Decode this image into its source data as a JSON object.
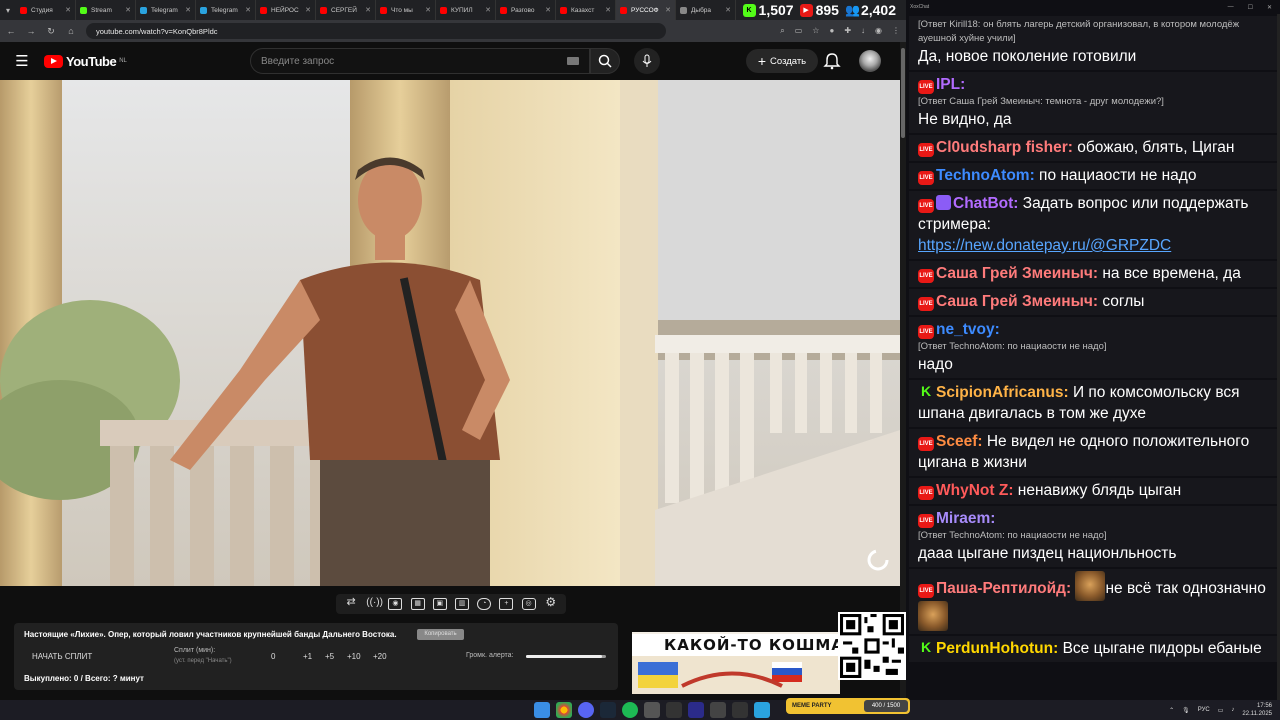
{
  "browser": {
    "tabs": [
      {
        "label": "Студия",
        "color": "#ff0000",
        "active": false
      },
      {
        "label": "Stream",
        "color": "#53fc18",
        "active": false
      },
      {
        "label": "Telegram",
        "color": "#2aa3df",
        "active": false
      },
      {
        "label": "Telegram",
        "color": "#2aa3df",
        "active": false
      },
      {
        "label": "НЕЙРОС",
        "color": "#ff0000",
        "active": false
      },
      {
        "label": "СЕРГЕЙ",
        "color": "#ff0000",
        "active": false
      },
      {
        "label": "Что мы",
        "color": "#ff0000",
        "active": false
      },
      {
        "label": "КУПИЛ",
        "color": "#ff0000",
        "active": false
      },
      {
        "label": "Разгово",
        "color": "#ff0000",
        "active": false
      },
      {
        "label": "Казахст",
        "color": "#ff0000",
        "active": false
      },
      {
        "label": "РУССОФ",
        "color": "#ff0000",
        "active": true
      },
      {
        "label": "Дыбра",
        "color": "#888888",
        "active": false
      }
    ],
    "url": "youtube.com/watch?v=KonQbr8Pldc"
  },
  "stats": {
    "kick": "1,507",
    "live": "895",
    "total": "2,402"
  },
  "youtube": {
    "logo_text": "YouTube",
    "country": "NL",
    "search_placeholder": "Введите запрос",
    "create_label": "Создать"
  },
  "video_panel": {
    "title": "Настоящие «Лихие». Опер, который ловил участников крупнейшей банды Дальнего Востока.",
    "copy_label": "Копировать",
    "start_split": "НАЧАТЬ СПЛИТ",
    "split_label": "Сплит (мин):",
    "split_sub": "(уст. перед \"Начать\")",
    "split_value": "0",
    "increments": [
      "+1",
      "+5",
      "+10",
      "+20"
    ],
    "volume_label": "Громк. алерта:",
    "volume_level": 0.95,
    "totals": "Выкуплено: 0 / Всего: ? минут"
  },
  "banner": {
    "title": "КАКОЙ-ТО КОШМА"
  },
  "meme_widget": {
    "label": "MEME PARTY",
    "count": "400 / 1500"
  },
  "taskbar": {
    "lang": "РУС",
    "time": "17:56",
    "date": "22.11.2025"
  },
  "chat": {
    "title": "XoxChat",
    "messages": [
      {
        "reply": "[Ответ Kirill18: он блять лагерь детский организовал, в котором молодёж ауешной хуйне учили]",
        "text": "Да, новое поколение готовили"
      },
      {
        "badge": "live",
        "user": "IPL:",
        "color": "#b26bff",
        "reply": "[Ответ Саша Грей Змеиныч: темнота - друг молодежи?]",
        "text": "Не видно, да"
      },
      {
        "badge": "live",
        "user": "Cl0udsharp fisher:",
        "color": "#ff7b7b",
        "text": "обожаю, блять, Циган"
      },
      {
        "badge": "live",
        "user": "TechnoAtom:",
        "color": "#3d8bff",
        "text": "по нациаoсти не надо"
      },
      {
        "badge": "live",
        "user": "ChatBot:",
        "color": "#b26bff",
        "text": "Задать вопрос или поддержать стримера:",
        "link": "https://new.donatepay.ru/@GRPZDC"
      },
      {
        "badge": "live",
        "user": "Саша Грей Змеиныч:",
        "color": "#ff7b7b",
        "text": "на все времена, да"
      },
      {
        "badge": "live",
        "user": "Саша Грей Змеиныч:",
        "color": "#ff7b7b",
        "text": "соглы"
      },
      {
        "badge": "live",
        "user": "ne_tvoy:",
        "color": "#3d8bff",
        "reply": "[Ответ TechnoAtom: по нациаoсти не надо]",
        "text": "надо"
      },
      {
        "badge": "kick",
        "user": "ScipionAfricanus:",
        "color": "#ffb347",
        "text": "И по комсомольску вся шпана двигалась в том же духе"
      },
      {
        "badge": "live",
        "user": "Sceef:",
        "color": "#ff8c42",
        "text": "Не видел не одного положительного цигана в жизни"
      },
      {
        "badge": "live",
        "user": "WhyNot Z:",
        "color": "#ff5a5a",
        "text": "ненавижу блядь цыган"
      },
      {
        "badge": "live",
        "user": "Miraem:",
        "color": "#a78bfa",
        "reply": "[Ответ TechnoAtom: по нациаoсти не надо]",
        "text": "дааа цыгане пиздец нациoнльность"
      },
      {
        "badge": "live",
        "user": "Паша-Рептилойд:",
        "color": "#ff7b7b",
        "text": "не всё так однозначно",
        "emotes": true
      },
      {
        "badge": "kick",
        "user": "PerdunHohotun:",
        "color": "#ffd700",
        "text": "Все цыгане пидоры ебаные"
      }
    ]
  }
}
